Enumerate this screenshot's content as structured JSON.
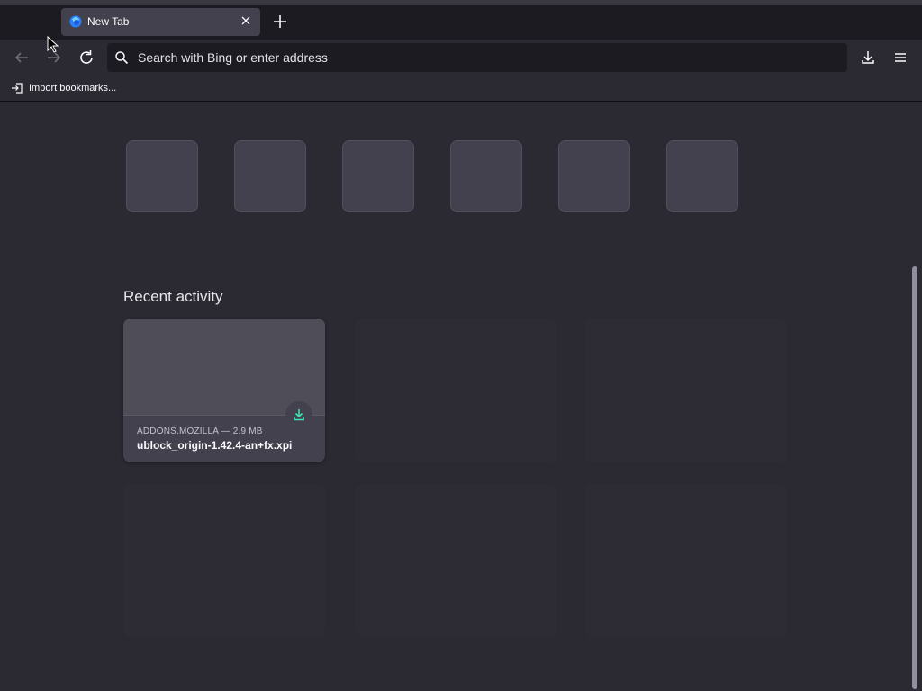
{
  "tab": {
    "title": "New Tab"
  },
  "urlbar": {
    "placeholder": "Search with Bing or enter address"
  },
  "bookmarks": {
    "import_label": "Import bookmarks..."
  },
  "recent_activity": {
    "heading": "Recent activity",
    "items": [
      {
        "source": "ADDONS.MOZILLA — 2.9 MB",
        "title": "ublock_origin-1.42.4-an+fx.xpi"
      }
    ]
  },
  "colors": {
    "background": "#2b2a33",
    "tabstrip": "#1c1b22",
    "accent_download": "#3fe1b0"
  },
  "icons": [
    "firefox-logo-icon",
    "close-icon",
    "plus-icon",
    "back-arrow-icon",
    "forward-arrow-icon",
    "reload-icon",
    "search-icon",
    "download-icon",
    "menu-icon",
    "import-icon"
  ]
}
